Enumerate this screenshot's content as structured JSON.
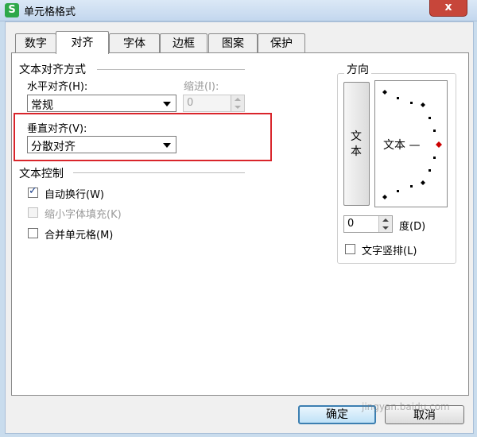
{
  "window": {
    "icon_letter": "S",
    "title": "单元格格式",
    "close_glyph": "x"
  },
  "tabs": [
    {
      "label": "数字",
      "active": false
    },
    {
      "label": "对齐",
      "active": true
    },
    {
      "label": "字体",
      "active": false
    },
    {
      "label": "边框",
      "active": false
    },
    {
      "label": "图案",
      "active": false
    },
    {
      "label": "保护",
      "active": false
    }
  ],
  "alignment": {
    "section_title": "文本对齐方式",
    "horizontal_label": "水平对齐(H):",
    "horizontal_value": "常规",
    "indent_label": "缩进(I):",
    "indent_value": "0",
    "vertical_label": "垂直对齐(V):",
    "vertical_value": "分散对齐"
  },
  "text_control": {
    "section_title": "文本控制",
    "wrap_text": {
      "label": "自动换行(W)",
      "checked": true,
      "enabled": true
    },
    "shrink_to_fit": {
      "label": "缩小字体填充(K)",
      "checked": false,
      "enabled": false
    },
    "merge_cells": {
      "label": "合并单元格(M)",
      "checked": false,
      "enabled": true
    }
  },
  "orientation": {
    "section_title": "方向",
    "vertical_text_chars": [
      "文",
      "本"
    ],
    "dial_text": "文本 —",
    "degree_value": "0",
    "degree_label": "度(D)",
    "vertical_text_checkbox": {
      "label": "文字竖排(L)",
      "checked": false
    }
  },
  "buttons": {
    "ok": "确定",
    "cancel": "取消"
  },
  "colors": {
    "highlight": "#d9252b",
    "app_icon": "#2ea84a",
    "close": "#c7463a",
    "dial_pointer": "#cc0000"
  },
  "watermark": "jingyan.baidu.com"
}
